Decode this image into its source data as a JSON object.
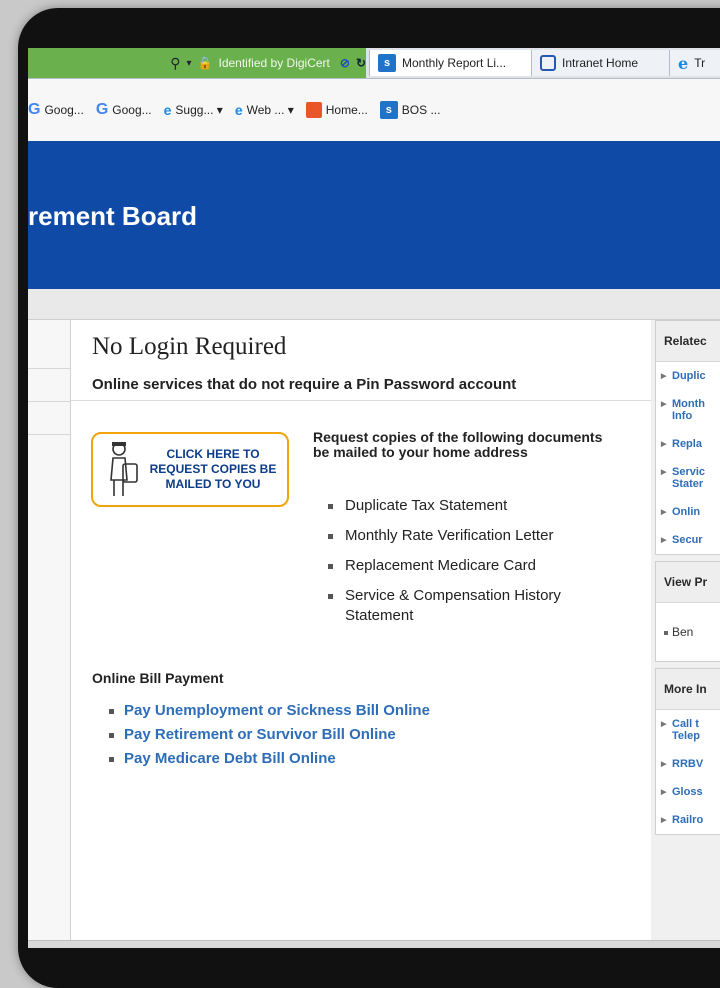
{
  "browser": {
    "address_cert_text": "Identified by DigiCert",
    "tabs": [
      {
        "label": "Monthly Report Li...",
        "icon": "sharepoint-icon",
        "active": true
      },
      {
        "label": "Intranet Home",
        "icon": "intranet-icon",
        "active": false
      },
      {
        "label": "Tr",
        "icon": "ie-icon",
        "active": false
      }
    ],
    "favorites": [
      {
        "label": "Goog...",
        "icon": "google-icon"
      },
      {
        "label": "Goog...",
        "icon": "google-icon"
      },
      {
        "label": "Sugg... ▾",
        "icon": "ie-icon"
      },
      {
        "label": "Web ... ▾",
        "icon": "ie-icon"
      },
      {
        "label": "Home...",
        "icon": "home-icon"
      },
      {
        "label": "BOS ...",
        "icon": "sharepoint-icon"
      }
    ],
    "colors": {
      "address_bg": "#6ab04c",
      "header_bg": "#0f4aa6",
      "link": "#2e6db7",
      "cta_border": "#f0a30a"
    }
  },
  "site": {
    "title": "rement Board"
  },
  "main": {
    "heading": "No Login Required",
    "subheading": "Online services that do not require a Pin Password account",
    "cta_label": "CLICK HERE TO REQUEST COPIES BE MAILED TO YOU",
    "request_intro": "Request copies of the following documents be mailed to your home address",
    "documents": [
      "Duplicate Tax Statement",
      "Monthly Rate Verification Letter",
      "Replacement Medicare Card",
      "Service & Compensation History Statement"
    ],
    "bill_heading": "Online Bill Payment",
    "bill_links": [
      "Pay Unemployment or Sickness Bill Online",
      "Pay Retirement or Survivor Bill Online",
      "Pay Medicare Debt Bill Online"
    ]
  },
  "sidebar": {
    "related_heading": "Relatec",
    "related_links": [
      "Duplic",
      "Month Info",
      "Repla",
      "Servic Stater",
      "Onlin",
      "Secur"
    ],
    "view_heading": "View Pr",
    "view_item": "Ben",
    "more_heading": "More In",
    "more_links": [
      "Call t Telep",
      "RRBV",
      "Gloss",
      "Railro"
    ]
  }
}
